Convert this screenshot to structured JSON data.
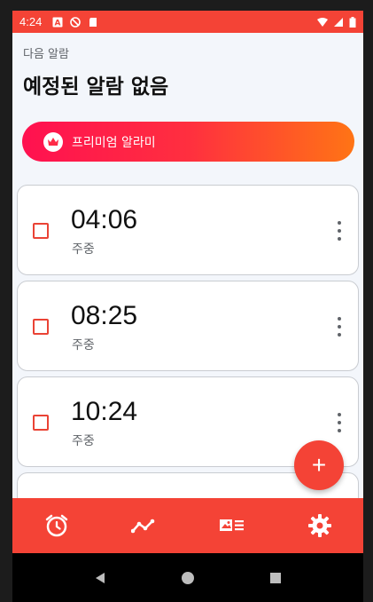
{
  "status_bar": {
    "time": "4:24"
  },
  "header": {
    "next_alarm_label": "다음 알람",
    "headline": "예정된 알람 없음"
  },
  "premium_banner": {
    "label": "프리미엄 알라미"
  },
  "alarms": [
    {
      "time": "04:06",
      "days": "주중"
    },
    {
      "time": "08:25",
      "days": "주중"
    },
    {
      "time": "10:24",
      "days": "주중"
    }
  ],
  "fab": {
    "symbol": "+"
  },
  "bottom_nav": {
    "items": [
      "alarm-clock-icon",
      "chart-line-icon",
      "news-icon",
      "gear-icon"
    ]
  },
  "colors": {
    "accent": "#f44336",
    "gradient_start": "#ff1150",
    "gradient_end": "#ff7415"
  }
}
